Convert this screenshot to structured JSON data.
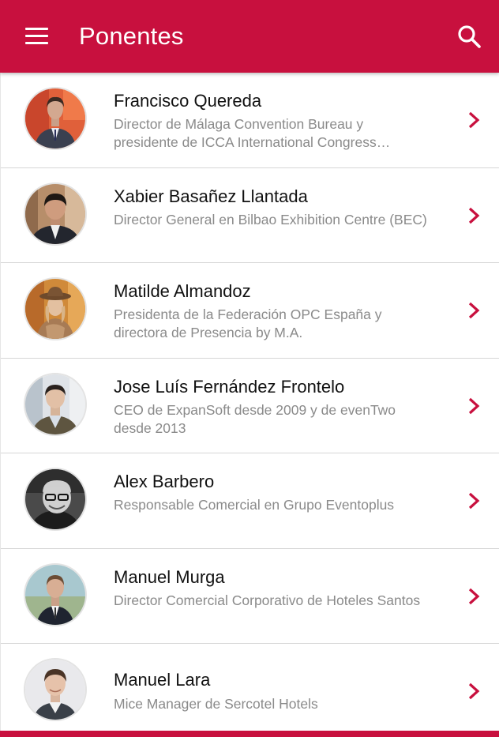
{
  "app_bar": {
    "title": "Ponentes",
    "color": "#c8103e"
  },
  "icons": {
    "menu": "menu-icon",
    "search": "search-icon",
    "chevron": "chevron-right-icon"
  },
  "speakers": [
    {
      "name": "Francisco Quereda",
      "description": "Director de Málaga Convention Bureau y presidente de ICCA International Congress…"
    },
    {
      "name": "Xabier Basañez Llantada",
      "description": "Director General en Bilbao Exhibition Centre (BEC)"
    },
    {
      "name": "Matilde Almandoz",
      "description": "Presidenta de la Federación OPC España y directora de Presencia by M.A."
    },
    {
      "name": "Jose Luís Fernández Frontelo",
      "description": "CEO de ExpanSoft desde 2009 y de evenTwo desde 2013"
    },
    {
      "name": "Alex Barbero",
      "description": "Responsable Comercial en Grupo Eventoplus"
    },
    {
      "name": "Manuel Murga",
      "description": "Director Comercial Corporativo de Hoteles Santos"
    },
    {
      "name": "Manuel Lara",
      "description": "Mice Manager de Sercotel Hotels"
    }
  ]
}
